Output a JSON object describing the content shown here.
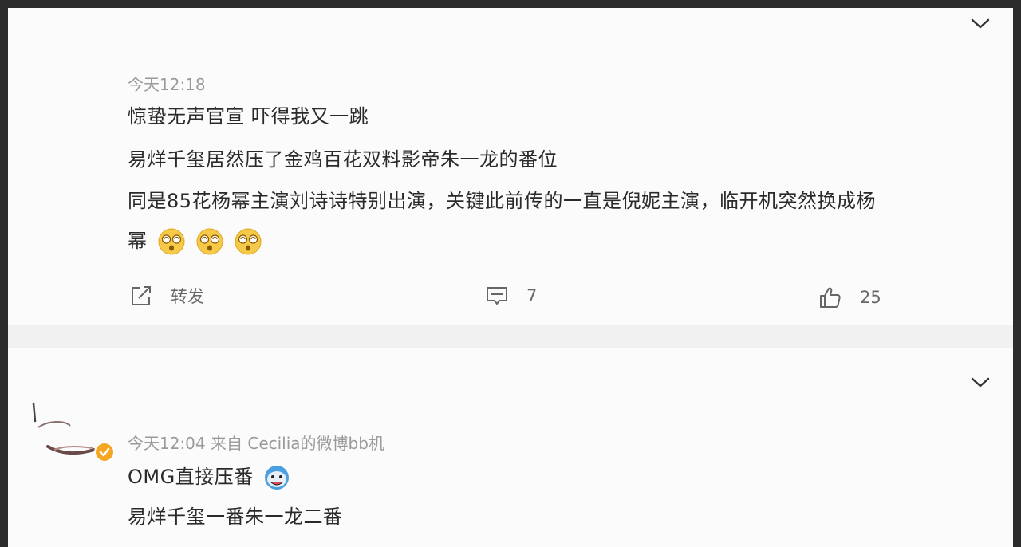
{
  "post": {
    "time": "今天12:18",
    "lines": [
      "惊蛰无声官宣 吓得我又一跳",
      "易烊千玺居然压了金鸡百花双料影帝朱一龙的番位",
      "同是85花杨幂主演刘诗诗特别出演，关键此前传的一直是倪妮主演，临开机突然换成杨",
      "幂"
    ],
    "emojis": [
      "dizzy-face-emoji",
      "dizzy-face-emoji",
      "dizzy-face-emoji"
    ],
    "actions": {
      "repost_label": "转发",
      "comment_count": "7",
      "like_count": "25"
    }
  },
  "comment": {
    "meta": "今天12:04  来自 Cecilia的微博bb机",
    "lines": [
      "OMG直接压番",
      "易烊千玺一番朱一龙二番"
    ],
    "emoji": "doge-emoji"
  },
  "colors": {
    "badge": "#f5a623",
    "text": "#2a2a2a",
    "muted": "#9a9a9a"
  }
}
